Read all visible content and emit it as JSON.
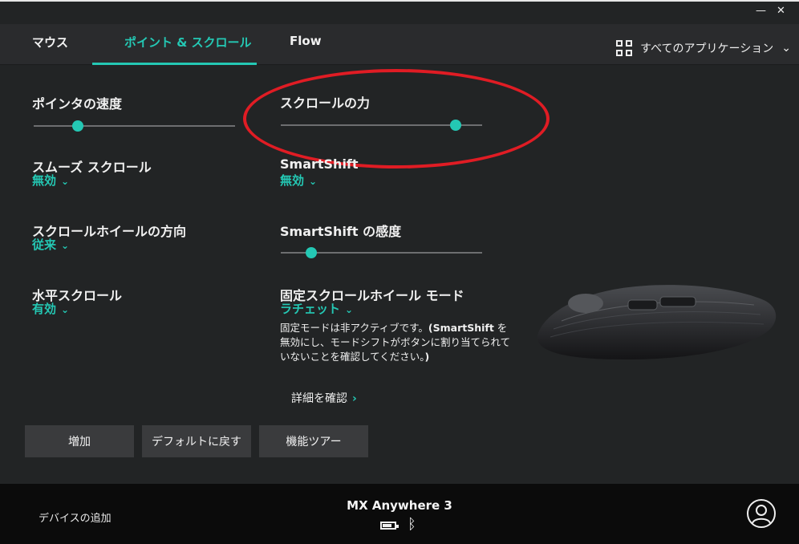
{
  "window": {
    "minimize": "—",
    "close": "✕"
  },
  "nav": {
    "tabs": [
      {
        "label": "マウス"
      },
      {
        "label": "ポイント & スクロール",
        "active": true
      },
      {
        "label": "Flow"
      }
    ],
    "app_selector": {
      "label": "すべてのアプリケーション",
      "icon": "grid-icon",
      "chevron": "⌄"
    }
  },
  "settings": {
    "pointer_speed": {
      "label": "ポインタの速度",
      "level_pct": 22
    },
    "scroll_force": {
      "label": "スクロールの力",
      "level_pct": 87
    },
    "smooth_scroll": {
      "label": "スムーズ スクロール",
      "value": "無効"
    },
    "smartshift": {
      "label": "SmartShift",
      "value": "無効"
    },
    "scroll_direction": {
      "label": "スクロールホイールの方向",
      "value": "従来"
    },
    "smartshift_sensitivity": {
      "label": "SmartShift の感度",
      "level_pct": 15
    },
    "horizontal_scroll": {
      "label": "水平スクロール",
      "value": "有効"
    },
    "fixed_wheel_mode": {
      "label": "固定スクロールホイール モード",
      "value": "ラチェット"
    },
    "note": {
      "part1": "固定モードは非アクティブです。",
      "bold": "(SmartShift",
      "part2": " を無効にし、モードシフトがボタンに割り当てられていないことを確認してください。",
      "close": ")"
    },
    "learn_more": {
      "label": "詳細を確認",
      "arrow": "›"
    }
  },
  "buttons": {
    "add": "増加",
    "reset": "デフォルトに戻す",
    "tour": "機能ツアー"
  },
  "footer": {
    "add_device": "デバイスの追加",
    "device_name": "MX Anywhere 3",
    "battery_level_pct": 80,
    "bluetooth_icon": "ᛒ"
  },
  "colors": {
    "accent": "#24c8b4",
    "annotation": "#e01c24",
    "background": "#222425",
    "footer": "#0b0b0b"
  }
}
